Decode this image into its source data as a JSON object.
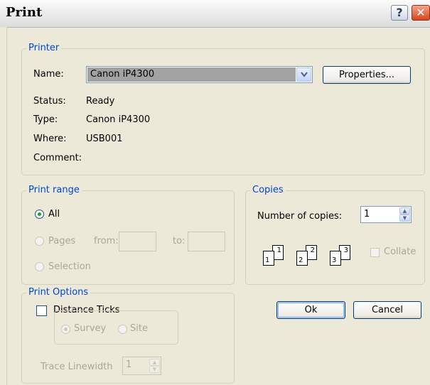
{
  "window": {
    "title": "Print",
    "help_icon": "?",
    "close_icon": "✕"
  },
  "printer": {
    "group_label": "Printer",
    "name_label": "Name:",
    "name_value": "Canon iP4300",
    "dropdown_icon": "chevron-down-icon",
    "properties_button": "Properties...",
    "status_label": "Status:",
    "status_value": "Ready",
    "type_label": "Type:",
    "type_value": "Canon iP4300",
    "where_label": "Where:",
    "where_value": "USB001",
    "comment_label": "Comment:",
    "comment_value": ""
  },
  "print_range": {
    "group_label": "Print range",
    "all_label": "All",
    "pages_label": "Pages",
    "from_label": "from:",
    "to_label": "to:",
    "from_value": "",
    "to_value": "",
    "selection_label": "Selection",
    "selected": "All"
  },
  "copies": {
    "group_label": "Copies",
    "number_label": "Number of copies:",
    "number_value": "1",
    "collate_label": "Collate",
    "collate_checked": false,
    "page_numbers": [
      "1",
      "1",
      "2",
      "2",
      "3",
      "3"
    ]
  },
  "print_options": {
    "group_label": "Print Options",
    "distance_ticks_label": "Distance Ticks",
    "distance_ticks_checked": false,
    "survey_label": "Survey",
    "site_label": "Site",
    "trace_linewidth_label": "Trace Linewidth",
    "trace_linewidth_value": "1"
  },
  "buttons": {
    "ok": "Ok",
    "cancel": "Cancel"
  },
  "colors": {
    "legend": "#0046d5",
    "dialog_bg": "#ece9d8",
    "selected_field": "#a2a2a2"
  }
}
